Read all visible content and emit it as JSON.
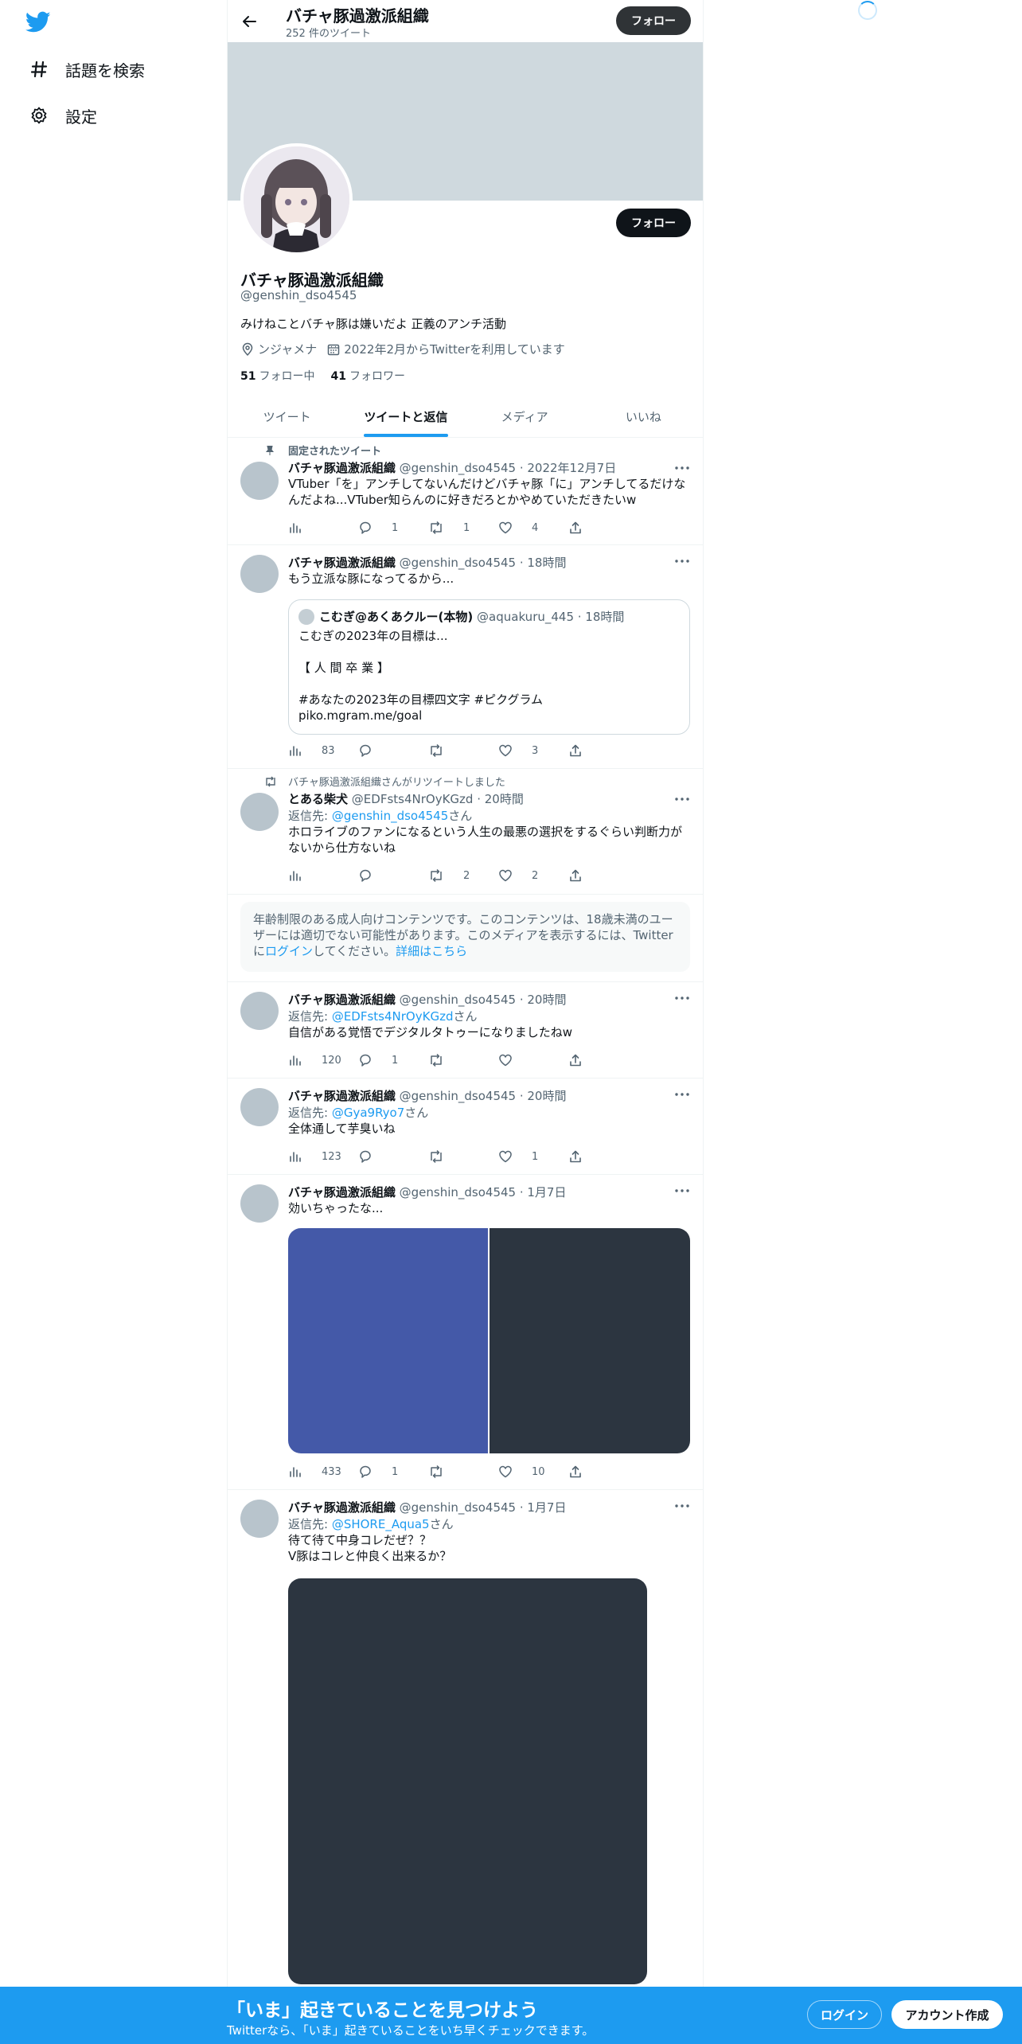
{
  "nav": {
    "items": [
      {
        "label": "話題を検索",
        "icon": "hashtag-icon"
      },
      {
        "label": "設定",
        "icon": "gear-icon"
      }
    ]
  },
  "profile_header": {
    "name": "バチャ豚過激派組織",
    "tweet_count": "252 件のツイート",
    "follow_label": "フォロー"
  },
  "profile": {
    "name": "バチャ豚過激派組織",
    "handle": "@genshin_dso4545",
    "bio": "みけねことバチャ豚は嫌いだよ 正義のアンチ活動",
    "location": "ンジャメナ",
    "joined": "2022年2月からTwitterを利用しています",
    "following_count": "51",
    "following_label": "フォロー中",
    "followers_count": "41",
    "followers_label": "フォロワー",
    "follow_label": "フォロー"
  },
  "tabs": [
    {
      "label": "ツイート",
      "active": false
    },
    {
      "label": "ツイートと返信",
      "active": true
    },
    {
      "label": "メディア",
      "active": false
    },
    {
      "label": "いいね",
      "active": false
    }
  ],
  "tweets": [
    {
      "note": "固定されたツイート",
      "name": "バチャ豚過激派組織",
      "meta": "@genshin_dso4545 · 2022年12月7日",
      "text_lines": [
        "VTuber「を」アンチしてないんだけどバチャ豚「に」アンチしてるだけな",
        "んだよね...VTuber知らんのに好きだろとかやめていただきたいw"
      ],
      "views": "",
      "replies": "1",
      "retweets": "1",
      "likes": "4"
    },
    {
      "name": "バチャ豚過激派組織",
      "meta": "@genshin_dso4545 · 18時間",
      "text_lines": [
        "もう立派な豚になってるから..."
      ],
      "quote": {
        "name": "こむぎ@あくあクルー(本物)",
        "meta": "@aquakuru_445 · 18時間",
        "lines": [
          "こむぎの2023年の目標は...",
          "",
          "【 人 間 卒 業 】",
          "",
          "#あなたの2023年の目標四文字 #ピクグラム",
          " piko.mgram.me/goal"
        ]
      },
      "views": "83",
      "replies": "",
      "retweets": "",
      "likes": "3"
    },
    {
      "note": "バチャ豚過激派組織さんがリツイートしました",
      "name": "とある柴犬",
      "meta": "@EDFsts4NrOyKGzd · 20時間",
      "reply_prefix": "返信先: ",
      "reply_handle": "@genshin_dso4545",
      "reply_suffix": "さん",
      "text_lines": [
        "ホロライブのファンになるという人生の最悪の選択をするぐらい判断力が",
        "ないから仕方ないね"
      ],
      "views": "",
      "replies": "",
      "retweets": "2",
      "likes": "2"
    },
    {
      "name": "バチャ豚過激派組織",
      "meta": "@genshin_dso4545 · 20時間",
      "reply_prefix": "返信先: ",
      "reply_handle": "@EDFsts4NrOyKGzd",
      "reply_suffix": "さん",
      "text_lines": [
        "自信がある覚悟でデジタルタトゥーになりましたねw"
      ],
      "views": "120",
      "replies": "1",
      "retweets": "",
      "likes": ""
    },
    {
      "name": "バチャ豚過激派組織",
      "meta": "@genshin_dso4545 · 20時間",
      "reply_prefix": "返信先: ",
      "reply_handle": "@Gya9Ryo7",
      "reply_suffix": "さん",
      "text_lines": [
        "全体通して芋臭いね"
      ],
      "views": "123",
      "replies": "",
      "retweets": "",
      "likes": "1"
    },
    {
      "name": "バチャ豚過激派組織",
      "meta": "@genshin_dso4545 · 1月7日",
      "text_lines": [
        "効いちゃったな..."
      ],
      "views": "433",
      "replies": "1",
      "retweets": "",
      "likes": "10"
    },
    {
      "name": "バチャ豚過激派組織",
      "meta": "@genshin_dso4545 · 1月7日",
      "reply_prefix": "返信先: ",
      "reply_handle": "@SHORE_Aqua5",
      "reply_suffix": "さん",
      "text_lines": [
        "待て待て中身コレだぜ？？",
        "V豚はコレと仲良く出来るか？"
      ]
    }
  ],
  "sensitive_notice": {
    "line1": "年齢制限のある成人向けコンテンツです。このコンテンツは、18歳未満のユー",
    "line2": "ザーには適切でない可能性があります。このメディアを表示するには、Twitter",
    "line3_pre": "に",
    "login_link": "ログイン",
    "line3_mid": "してください。",
    "details_link": "詳細はこちら"
  },
  "bottom_bar": {
    "title": "「いま」起きていることを見つけよう",
    "subtitle": "Twitterなら、「いま」起きていることをいち早くチェックできます。",
    "login_label": "ログイン",
    "signup_label": "アカウント作成"
  },
  "colors": {
    "accent": "#1d9bf0",
    "media_blue": "#4459a8",
    "media_dark": "#2c3540",
    "banner": "#cfd9de"
  }
}
